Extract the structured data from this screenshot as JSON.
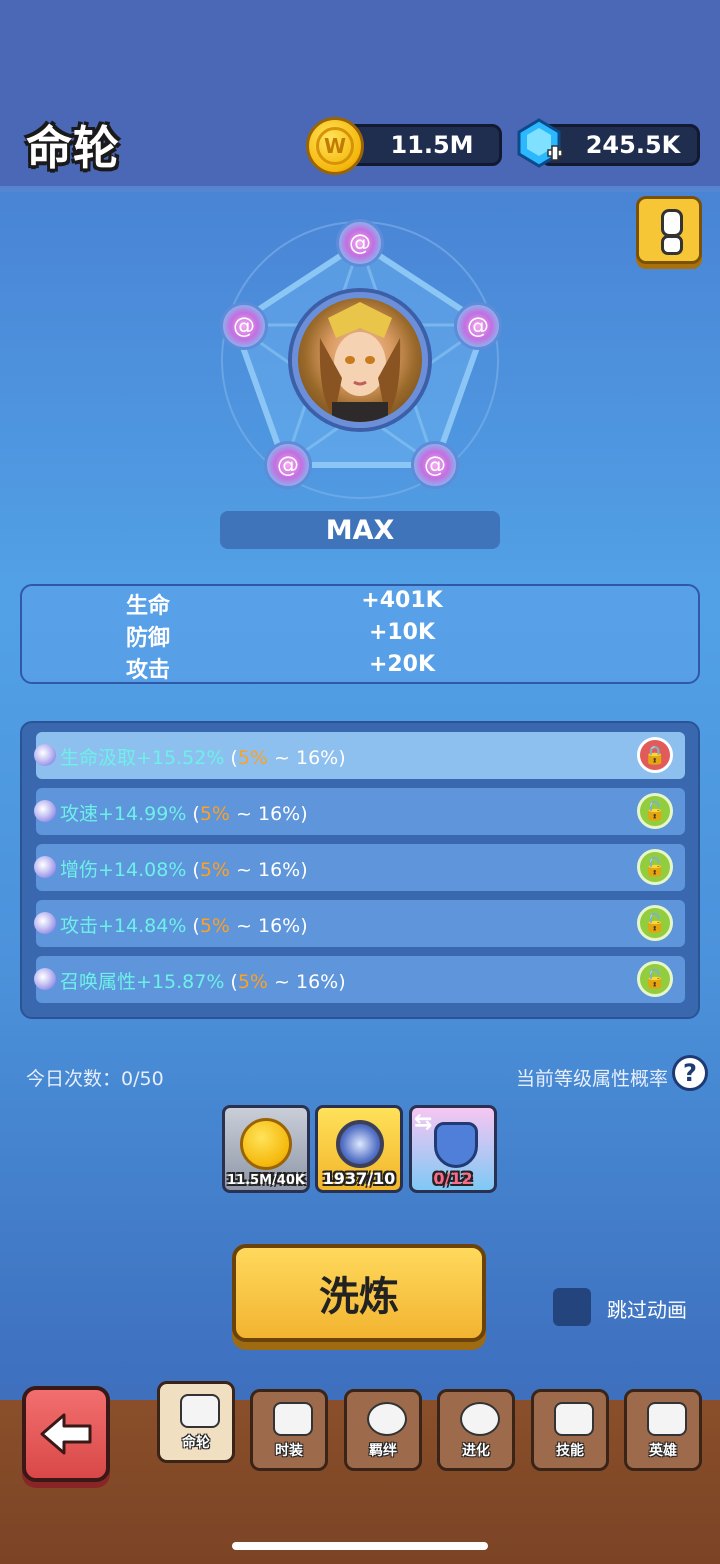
{
  "header": {
    "title": "命轮",
    "gold": "11.5M",
    "gems": "245.5K"
  },
  "wheel": {
    "level_label": "MAX"
  },
  "stats": [
    {
      "name": "生命",
      "value": "+401K"
    },
    {
      "name": "防御",
      "value": "+10K"
    },
    {
      "name": "攻击",
      "value": "+20K"
    }
  ],
  "attributes": [
    {
      "main": "生命汲取+15.52%",
      "open": " (",
      "low": "5%",
      "range": " ~ 16%)",
      "locked": true
    },
    {
      "main": "攻速+14.99%",
      "open": " (",
      "low": "5%",
      "range": " ~ 16%)",
      "locked": false
    },
    {
      "main": "增伤+14.08%",
      "open": " (",
      "low": "5%",
      "range": " ~ 16%)",
      "locked": false
    },
    {
      "main": "攻击+14.84%",
      "open": " (",
      "low": "5%",
      "range": " ~ 16%)",
      "locked": false
    },
    {
      "main": "召唤属性+15.87%",
      "open": " (",
      "low": "5%",
      "range": " ~ 16%)",
      "locked": false
    }
  ],
  "daily_count": "今日次数：0/50",
  "probability_label": "当前等级属性概率",
  "costs": [
    {
      "label": "11.5M/40K"
    },
    {
      "label": "1937/10"
    },
    {
      "label": "0/12"
    }
  ],
  "refine_button": "洗炼",
  "skip_animation": "跳过动画",
  "nav": [
    {
      "label": "命轮",
      "active": true
    },
    {
      "label": "时装",
      "active": false
    },
    {
      "label": "羁绊",
      "active": false
    },
    {
      "label": "进化",
      "active": false
    },
    {
      "label": "技能",
      "active": false
    },
    {
      "label": "英雄",
      "active": false
    }
  ],
  "colors": {
    "accent_teal": "#6df0e8",
    "accent_orange": "#ffa020",
    "button_yellow": "#f2b431",
    "back_red": "#d94848"
  }
}
